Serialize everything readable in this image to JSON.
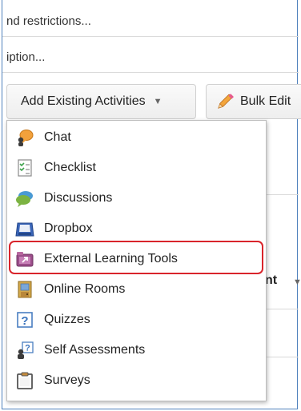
{
  "background_text": {
    "line1": "nd restrictions...",
    "line2": "iption...",
    "right_column_partial": "nt"
  },
  "toolbar": {
    "add_existing_label": "Add Existing Activities",
    "bulk_edit_label": "Bulk Edit"
  },
  "menu": {
    "items": [
      {
        "label": "Chat",
        "icon": "chat-icon"
      },
      {
        "label": "Checklist",
        "icon": "checklist-icon"
      },
      {
        "label": "Discussions",
        "icon": "discussions-icon"
      },
      {
        "label": "Dropbox",
        "icon": "dropbox-icon"
      },
      {
        "label": "External Learning Tools",
        "icon": "external-learning-tools-icon",
        "highlighted": true
      },
      {
        "label": "Online Rooms",
        "icon": "online-rooms-icon"
      },
      {
        "label": "Quizzes",
        "icon": "quizzes-icon"
      },
      {
        "label": "Self Assessments",
        "icon": "self-assessments-icon"
      },
      {
        "label": "Surveys",
        "icon": "surveys-icon"
      }
    ]
  },
  "colors": {
    "highlight_border": "#d9242b",
    "frame_border": "#4f81bd"
  }
}
